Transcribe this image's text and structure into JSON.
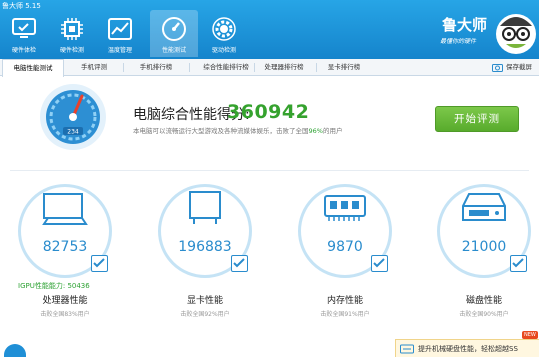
{
  "app": {
    "version": "鲁大师 5.15"
  },
  "nav": [
    {
      "label": "硬件体检",
      "icon": "monitor-check-icon",
      "active": false
    },
    {
      "label": "硬件检测",
      "icon": "chip-icon",
      "active": false
    },
    {
      "label": "温度管理",
      "icon": "thermometer-chart-icon",
      "active": false
    },
    {
      "label": "性能测试",
      "icon": "speedometer-icon",
      "active": true
    },
    {
      "label": "驱动检测",
      "icon": "gear-icon",
      "active": false
    }
  ],
  "brand": {
    "name": "鲁大师",
    "slogan": "最懂你的硬件"
  },
  "tabs": [
    {
      "label": "电脑性能测试",
      "active": true
    },
    {
      "label": "手机评测",
      "active": false
    },
    {
      "label": "手机排行榜",
      "active": false
    },
    {
      "label": "综合性能排行榜",
      "active": false
    },
    {
      "label": "处理器排行榜",
      "active": false
    },
    {
      "label": "显卡排行榜",
      "active": false
    }
  ],
  "toolbar": {
    "save_label": "保存截屏"
  },
  "summary": {
    "score_label": "电脑综合性能得分:",
    "score": "360942",
    "desc_prefix": "本电脑可以流畅运行大型游戏及各种流媒体娱乐，击败了全国",
    "desc_pct": "96%",
    "desc_suffix": "的用户",
    "gauge_value": "234",
    "start_button": "开始评测"
  },
  "components": [
    {
      "name": "处理器性能",
      "score": "82753",
      "rank": "击败全国83%用户",
      "icon": "cpu-monitor-icon",
      "extra_label": "IGPU性能能力:",
      "extra_value": "50436"
    },
    {
      "name": "显卡性能",
      "score": "196883",
      "rank": "击败全国92%用户",
      "icon": "graphics-card-icon"
    },
    {
      "name": "内存性能",
      "score": "9870",
      "rank": "击败全国91%用户",
      "icon": "memory-icon"
    },
    {
      "name": "磁盘性能",
      "score": "21000",
      "rank": "击败全国90%用户",
      "icon": "hard-disk-icon"
    }
  ],
  "promo": {
    "text": "提升机械硬盘性能，轻松超越SS",
    "badge": "NEW"
  },
  "colors": {
    "header": "#1f95dc",
    "score_green": "#35a22e",
    "accent_blue": "#2a8ccd",
    "button_green": "#66b93a"
  }
}
